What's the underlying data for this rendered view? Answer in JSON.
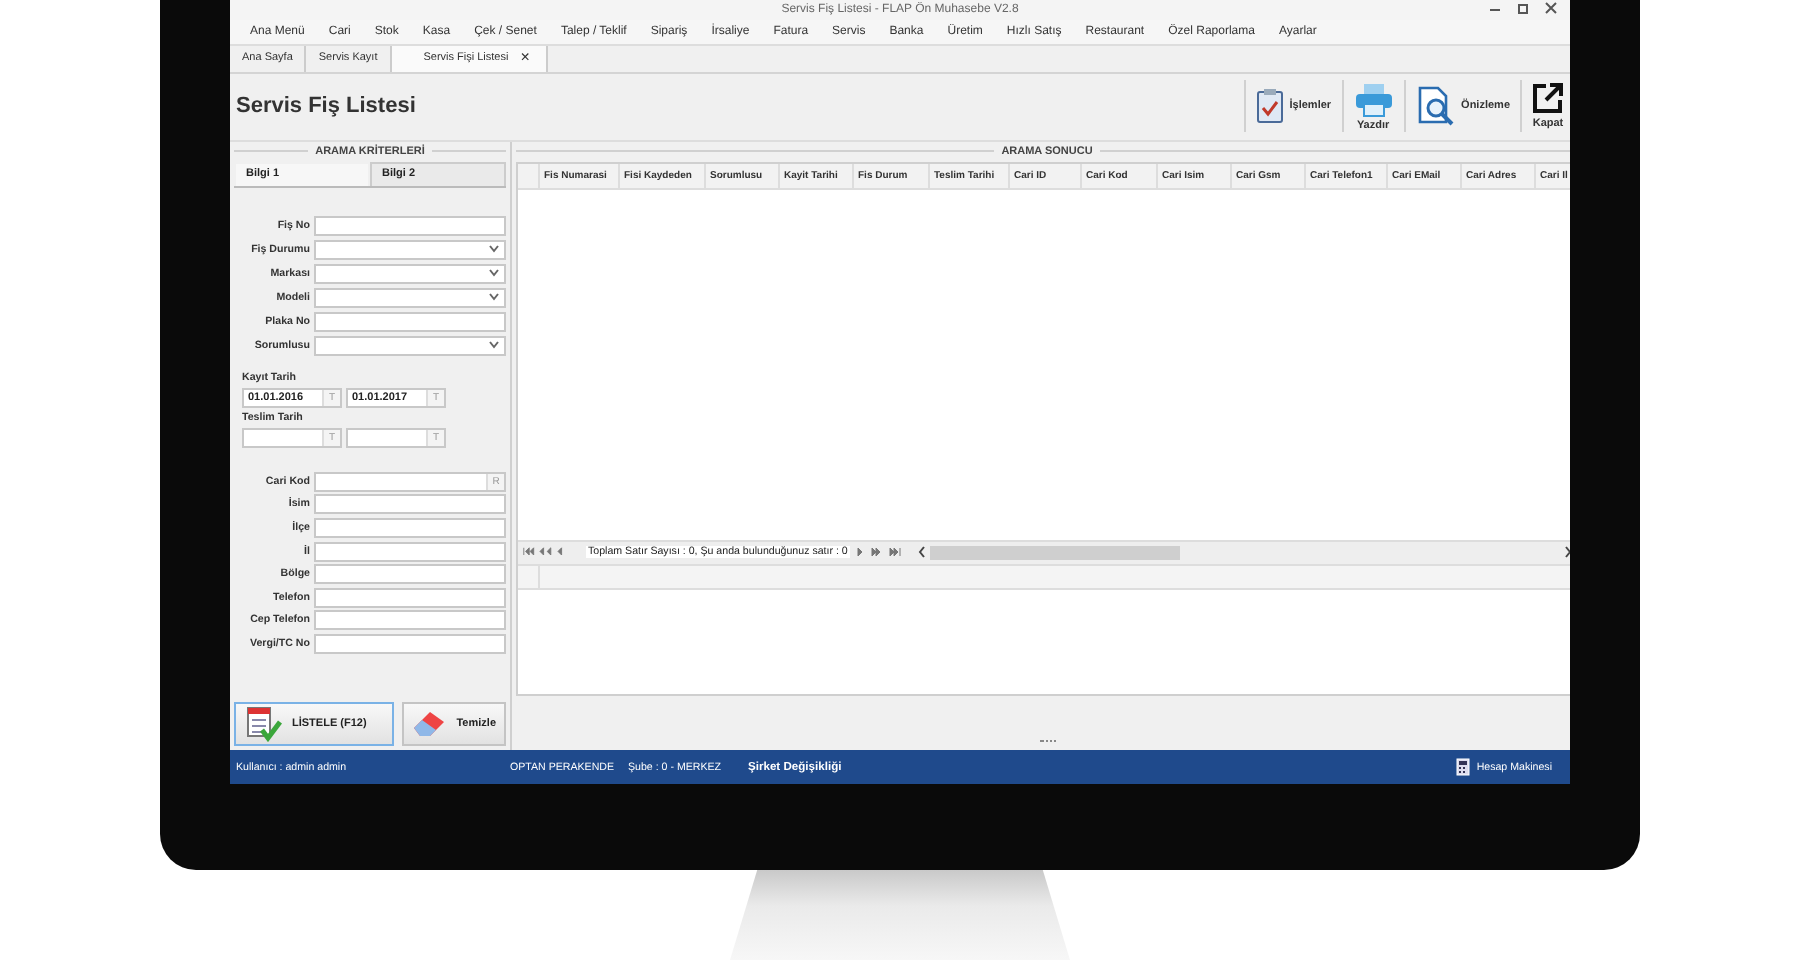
{
  "window": {
    "title": "Servis Fiş Listesi - FLAP Ön Muhasebe V2.8"
  },
  "menu": [
    "Ana Menü",
    "Cari",
    "Stok",
    "Kasa",
    "Çek / Senet",
    "Talep / Teklif",
    "Sipariş",
    "İrsaliye",
    "Fatura",
    "Servis",
    "Banka",
    "Üretim",
    "Hızlı Satış",
    "Restaurant",
    "Özel Raporlama",
    "Ayarlar"
  ],
  "tabs": [
    {
      "label": "Ana Sayfa",
      "selected": false
    },
    {
      "label": "Servis Kayıt",
      "selected": false
    },
    {
      "label": "Servis Fişi Listesi",
      "selected": true,
      "close_glyph": "×"
    }
  ],
  "page_title": "Servis Fiş Listesi",
  "toolbar": [
    {
      "label": "İşlemler",
      "kind": "checklist"
    },
    {
      "label": "Yazdır",
      "kind": "printer"
    },
    {
      "label": "Önizleme",
      "kind": "preview"
    },
    {
      "label": "Kapat",
      "kind": "export"
    }
  ],
  "search_panel": {
    "title": "ARAMA KRİTERLERİ",
    "tabs": [
      {
        "label": "Bilgi 1",
        "selected": true
      },
      {
        "label": "Bilgi 2",
        "selected": false
      }
    ],
    "fields": [
      {
        "label": "Fiş No",
        "kind": "text"
      },
      {
        "label": "Fiş Durumu",
        "kind": "dropdown"
      },
      {
        "label": "Markası",
        "kind": "dropdown"
      },
      {
        "label": "Modeli",
        "kind": "dropdown"
      },
      {
        "label": "Plaka No",
        "kind": "text"
      },
      {
        "label": "Sorumlusu",
        "kind": "dropdown"
      }
    ],
    "date_groups": [
      {
        "label": "Kayıt Tarih",
        "from": {
          "value": "01.01.2016",
          "button": "T"
        },
        "to": {
          "value": "01.01.2017",
          "button": "T"
        }
      },
      {
        "label": "Teslim Tarih",
        "from": {
          "button": "T"
        },
        "to": {
          "button": "T"
        }
      }
    ],
    "customer_fields": [
      {
        "label": "Cari Kod",
        "kind": "lookup",
        "button": "R"
      },
      {
        "label": "İsim",
        "kind": "text"
      },
      {
        "label": "İlçe",
        "kind": "text"
      },
      {
        "label": "İl",
        "kind": "text"
      },
      {
        "label": "Bölge",
        "kind": "text"
      },
      {
        "label": "Telefon",
        "kind": "text"
      },
      {
        "label": "Cep Telefon",
        "kind": "text"
      },
      {
        "label": "Vergi/TC No",
        "kind": "text"
      }
    ],
    "buttons": [
      {
        "label": "LİSTELE (F12)",
        "kind": "list",
        "focused": true
      },
      {
        "label": "Temizle",
        "kind": "eraser",
        "focused": false
      }
    ]
  },
  "results": {
    "title": "ARAMA SONUCU",
    "columns": [
      "Fis Numarasi",
      "Fisi Kaydeden",
      "Sorumlusu",
      "Kayit Tarihi",
      "Fis Durum",
      "Teslim Tarihi",
      "Cari ID",
      "Cari Kod",
      "Cari Isim",
      "Cari Gsm",
      "Cari Telefon1",
      "Cari EMail",
      "Cari Adres",
      "Cari Il"
    ],
    "footer_text": "Toplam Satır Sayısı : 0, Şu anda bulunduğunuz satır : 0"
  },
  "status_bar": {
    "user": "Kullanıcı : admin admin",
    "company": "OPTAN PERAKENDE",
    "branch": "Şube : 0 - MERKEZ",
    "switch_link": "Şirket Değişikliği",
    "calculator": "Hesap Makinesi"
  }
}
